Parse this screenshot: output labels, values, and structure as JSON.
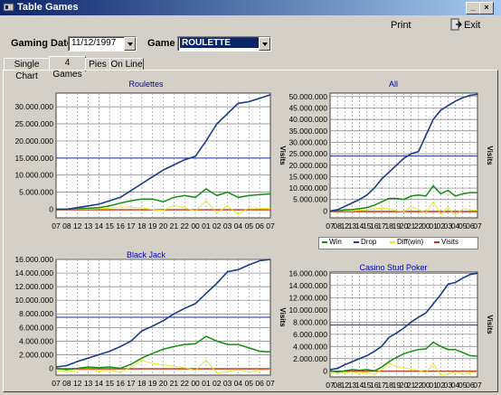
{
  "window": {
    "title": "Table Games"
  },
  "toolbar": {
    "print_label": "Print",
    "exit_label": "Exit"
  },
  "filters": {
    "date_label": "Gaming Date :",
    "date_value": "11/12/1997",
    "game_label": "Game :",
    "game_value": "ROULETTE"
  },
  "tabs": [
    "Single Chart",
    "4 Games",
    "Pies",
    "On Line"
  ],
  "active_tab": 1,
  "legend": {
    "items": [
      {
        "label": "Win",
        "color": "#109010"
      },
      {
        "label": "Drop",
        "color": "#1a3a8a"
      },
      {
        "label": "Diff(win)",
        "color": "#e8e820"
      },
      {
        "label": "Visits",
        "color": "#d03010"
      }
    ]
  },
  "chart_data": [
    {
      "type": "line",
      "title": "Roulettes",
      "ylabel": "Visits",
      "x": [
        "07",
        "08",
        "12",
        "13",
        "14",
        "15",
        "16",
        "17",
        "18",
        "19",
        "20",
        "21",
        "22",
        "00",
        "01",
        "02",
        "03",
        "04",
        "05",
        "06",
        "07"
      ],
      "ylim": [
        -2500000,
        34000000
      ],
      "yticks": [
        0,
        5000000,
        10000000,
        15000000,
        20000000,
        25000000,
        30000000
      ],
      "ytick_labels": [
        "0",
        "5.000.000",
        "10.000.000",
        "15.000.000",
        "20.000.000",
        "25.000.000",
        "30.000.000"
      ],
      "hline": 15000000,
      "series": [
        {
          "name": "Drop",
          "values": [
            0,
            0,
            500000,
            1000000,
            1500000,
            2500000,
            3500000,
            5500000,
            7500000,
            9500000,
            11500000,
            13000000,
            14500000,
            15500000,
            20000000,
            25000000,
            28000000,
            31000000,
            31500000,
            32500000,
            33500000
          ]
        },
        {
          "name": "Win",
          "values": [
            0,
            0,
            200000,
            300000,
            500000,
            1000000,
            1800000,
            2500000,
            3000000,
            3000000,
            2200000,
            3500000,
            4000000,
            3500000,
            6000000,
            4000000,
            5000000,
            3500000,
            4000000,
            4300000,
            4500000
          ]
        },
        {
          "name": "Diff(win)",
          "values": [
            0,
            0,
            100000,
            50000,
            200000,
            300000,
            700000,
            600000,
            400000,
            -100000,
            -300000,
            1200000,
            400000,
            -500000,
            2500000,
            -1000000,
            1000000,
            -1500000,
            500000,
            300000,
            200000
          ]
        },
        {
          "name": "Visits",
          "values": [
            -200000,
            -200000,
            -200000,
            -200000,
            -200000,
            -200000,
            -200000,
            -200000,
            -200000,
            -200000,
            -200000,
            -200000,
            -200000,
            -200000,
            -200000,
            -200000,
            -200000,
            -200000,
            -200000,
            -200000,
            -200000
          ]
        }
      ]
    },
    {
      "type": "line",
      "title": "All",
      "ylabel": "Visits",
      "x": [
        "07",
        "08",
        "12",
        "13",
        "14",
        "15",
        "16",
        "17",
        "18",
        "19",
        "20",
        "21",
        "22",
        "00",
        "01",
        "02",
        "03",
        "04",
        "05",
        "06",
        "07"
      ],
      "ylim": [
        -3000000,
        51500000
      ],
      "yticks": [
        0,
        5000000,
        10000000,
        15000000,
        20000000,
        25000000,
        30000000,
        35000000,
        40000000,
        45000000,
        50000000
      ],
      "ytick_labels": [
        "0",
        "5.000.000",
        "10.000.000",
        "15.000.000",
        "20.000.000",
        "25.000.000",
        "30.000.000",
        "35.000.000",
        "40.000.000",
        "45.000.000",
        "50.000.000"
      ],
      "hline": 24000000,
      "series": [
        {
          "name": "Drop",
          "values": [
            0,
            500000,
            2000000,
            3500000,
            5000000,
            7000000,
            10000000,
            14000000,
            17000000,
            20000000,
            23000000,
            25000000,
            26000000,
            33000000,
            40000000,
            44000000,
            46000000,
            48000000,
            49500000,
            50500000,
            51000000
          ]
        },
        {
          "name": "Win",
          "values": [
            0,
            0,
            500000,
            600000,
            1000000,
            1500000,
            2500000,
            4000000,
            5500000,
            5500000,
            5000000,
            6500000,
            7000000,
            6500000,
            11000000,
            7500000,
            9000000,
            6500000,
            7500000,
            8000000,
            8000000
          ]
        },
        {
          "name": "Diff(win)",
          "values": [
            0,
            0,
            200000,
            100000,
            400000,
            500000,
            1000000,
            1200000,
            1000000,
            200000,
            -300000,
            1800000,
            600000,
            -800000,
            4000000,
            -1500000,
            1500000,
            -2000000,
            1000000,
            500000,
            300000
          ]
        },
        {
          "name": "Visits",
          "values": [
            -300000,
            -300000,
            -300000,
            -300000,
            -300000,
            -300000,
            -300000,
            -300000,
            -300000,
            -300000,
            -300000,
            -300000,
            -300000,
            -300000,
            -300000,
            -300000,
            -300000,
            -300000,
            -300000,
            -300000,
            -300000
          ]
        }
      ]
    },
    {
      "type": "line",
      "title": "Black Jack",
      "ylabel": "Visits",
      "x": [
        "07",
        "08",
        "12",
        "13",
        "14",
        "15",
        "16",
        "17",
        "18",
        "19",
        "20",
        "21",
        "22",
        "00",
        "01",
        "02",
        "03",
        "04",
        "05",
        "06",
        "07"
      ],
      "ylim": [
        -1000000,
        16000000
      ],
      "yticks": [
        0,
        2000000,
        4000000,
        6000000,
        8000000,
        10000000,
        12000000,
        14000000,
        16000000
      ],
      "ytick_labels": [
        "0",
        "2.000.000",
        "4.000.000",
        "6.000.000",
        "8.000.000",
        "10.000.000",
        "12.000.000",
        "14.000.000",
        "16.000.000"
      ],
      "hline": 7500000,
      "series": [
        {
          "name": "Drop",
          "values": [
            200000,
            400000,
            1000000,
            1500000,
            2000000,
            2500000,
            3200000,
            4000000,
            5500000,
            6200000,
            7000000,
            8000000,
            8800000,
            9500000,
            11000000,
            12500000,
            14200000,
            14500000,
            15200000,
            15800000,
            16000000
          ]
        },
        {
          "name": "Win",
          "values": [
            0,
            -200000,
            0,
            200000,
            100000,
            200000,
            0,
            600000,
            1500000,
            2200000,
            2800000,
            3200000,
            3500000,
            3600000,
            4700000,
            4000000,
            3500000,
            3500000,
            3000000,
            2500000,
            2400000
          ]
        },
        {
          "name": "Diff(win)",
          "values": [
            -300000,
            -500000,
            -300000,
            -200000,
            -400000,
            -300000,
            -600000,
            200000,
            1200000,
            700000,
            500000,
            300000,
            100000,
            -300000,
            1200000,
            -700000,
            -500000,
            -200000,
            -600000,
            -300000,
            -200000
          ]
        },
        {
          "name": "Visits",
          "values": [
            -100000,
            -100000,
            -100000,
            -100000,
            -100000,
            -100000,
            -100000,
            -100000,
            -100000,
            -100000,
            -100000,
            -100000,
            -100000,
            -100000,
            -100000,
            -100000,
            -100000,
            -100000,
            -100000,
            -100000,
            -100000
          ]
        }
      ]
    },
    {
      "type": "line",
      "title": "Casino Stud Poker",
      "ylabel": "Visits",
      "x": [
        "07",
        "08",
        "12",
        "13",
        "14",
        "15",
        "16",
        "17",
        "18",
        "19",
        "20",
        "21",
        "22",
        "00",
        "01",
        "02",
        "03",
        "04",
        "05",
        "06",
        "07"
      ],
      "ylim": [
        -1000000,
        16200000
      ],
      "yticks": [
        0,
        2000000,
        4000000,
        6000000,
        8000000,
        10000000,
        12000000,
        14000000,
        16000000
      ],
      "ytick_labels": [
        "0",
        "2.000.000",
        "4.000.000",
        "6.000.000",
        "8.000.000",
        "10.000.000",
        "12.000.000",
        "14.000.000",
        "16.000.000"
      ],
      "hline": 7500000,
      "series": [
        {
          "name": "Drop",
          "values": [
            200000,
            400000,
            1000000,
            1500000,
            2000000,
            2500000,
            3200000,
            4000000,
            5500000,
            6200000,
            7000000,
            8000000,
            8800000,
            9500000,
            11000000,
            12500000,
            14200000,
            14500000,
            15200000,
            15800000,
            16000000
          ]
        },
        {
          "name": "Win",
          "values": [
            0,
            -200000,
            0,
            200000,
            100000,
            200000,
            0,
            600000,
            1500000,
            2200000,
            2800000,
            3200000,
            3500000,
            3600000,
            4700000,
            4000000,
            3500000,
            3500000,
            3000000,
            2500000,
            2400000
          ]
        },
        {
          "name": "Diff(win)",
          "values": [
            -300000,
            -500000,
            -300000,
            -200000,
            -400000,
            -300000,
            -600000,
            200000,
            1200000,
            700000,
            500000,
            300000,
            100000,
            -300000,
            1200000,
            -700000,
            -500000,
            -200000,
            -600000,
            -300000,
            -200000
          ]
        },
        {
          "name": "Visits",
          "values": [
            -100000,
            -100000,
            -100000,
            -100000,
            -100000,
            -100000,
            -100000,
            -100000,
            -100000,
            -100000,
            -100000,
            -100000,
            -100000,
            -100000,
            -100000,
            -100000,
            -100000,
            -100000,
            -100000,
            -100000,
            -100000
          ]
        }
      ]
    }
  ]
}
